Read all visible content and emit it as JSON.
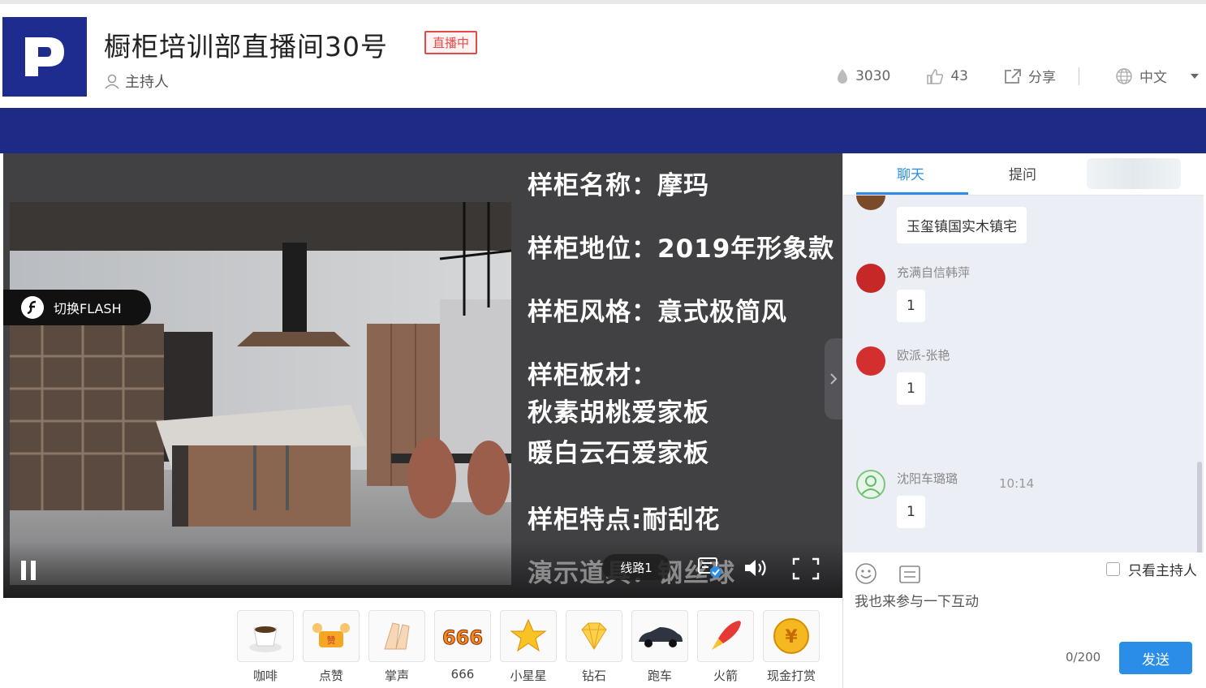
{
  "header": {
    "title": "橱柜培训部直播间30号",
    "live_badge": "直播中",
    "host_label": "主持人",
    "views": "3030",
    "likes": "43",
    "share_label": "分享",
    "language": "中文"
  },
  "player": {
    "flash_button": "切换FLASH",
    "line_button": "线路1",
    "spec_lines": [
      "样柜名称：摩玛",
      "样柜地位：2019年形象款",
      "样柜风格：意式极简风",
      "样柜板材：",
      "秋素胡桃爱家板",
      "暖白云石爱家板",
      "样柜特点:耐刮花",
      "演示道具：钢丝球"
    ]
  },
  "gifts": [
    {
      "label": "咖啡",
      "icon": "coffee-icon"
    },
    {
      "label": "点赞",
      "icon": "like-icon"
    },
    {
      "label": "掌声",
      "icon": "clap-icon"
    },
    {
      "label": "666",
      "icon": "666-icon"
    },
    {
      "label": "小星星",
      "icon": "star-icon"
    },
    {
      "label": "钻石",
      "icon": "diamond-icon"
    },
    {
      "label": "跑车",
      "icon": "car-icon"
    },
    {
      "label": "火箭",
      "icon": "rocket-icon"
    },
    {
      "label": "现金打赏",
      "icon": "coin-icon"
    }
  ],
  "chat": {
    "tabs": [
      "聊天",
      "提问"
    ],
    "messages": [
      {
        "user": "",
        "text": "玉玺镇国实木镇宅"
      },
      {
        "user": "充满自信韩萍",
        "text": "1"
      },
      {
        "user": "欧派-张艳",
        "text": "1"
      },
      {
        "user": "沈阳车璐璐",
        "text": "1"
      }
    ],
    "timestamp": "10:14",
    "host_only_label": "只看主持人",
    "input_placeholder": "我也来参与一下互动",
    "counter": "0/200",
    "send_label": "发送"
  },
  "colors": {
    "brand_blue": "#1d2a86",
    "accent_blue": "#2a8ee8",
    "live_red": "#e34b4b"
  }
}
